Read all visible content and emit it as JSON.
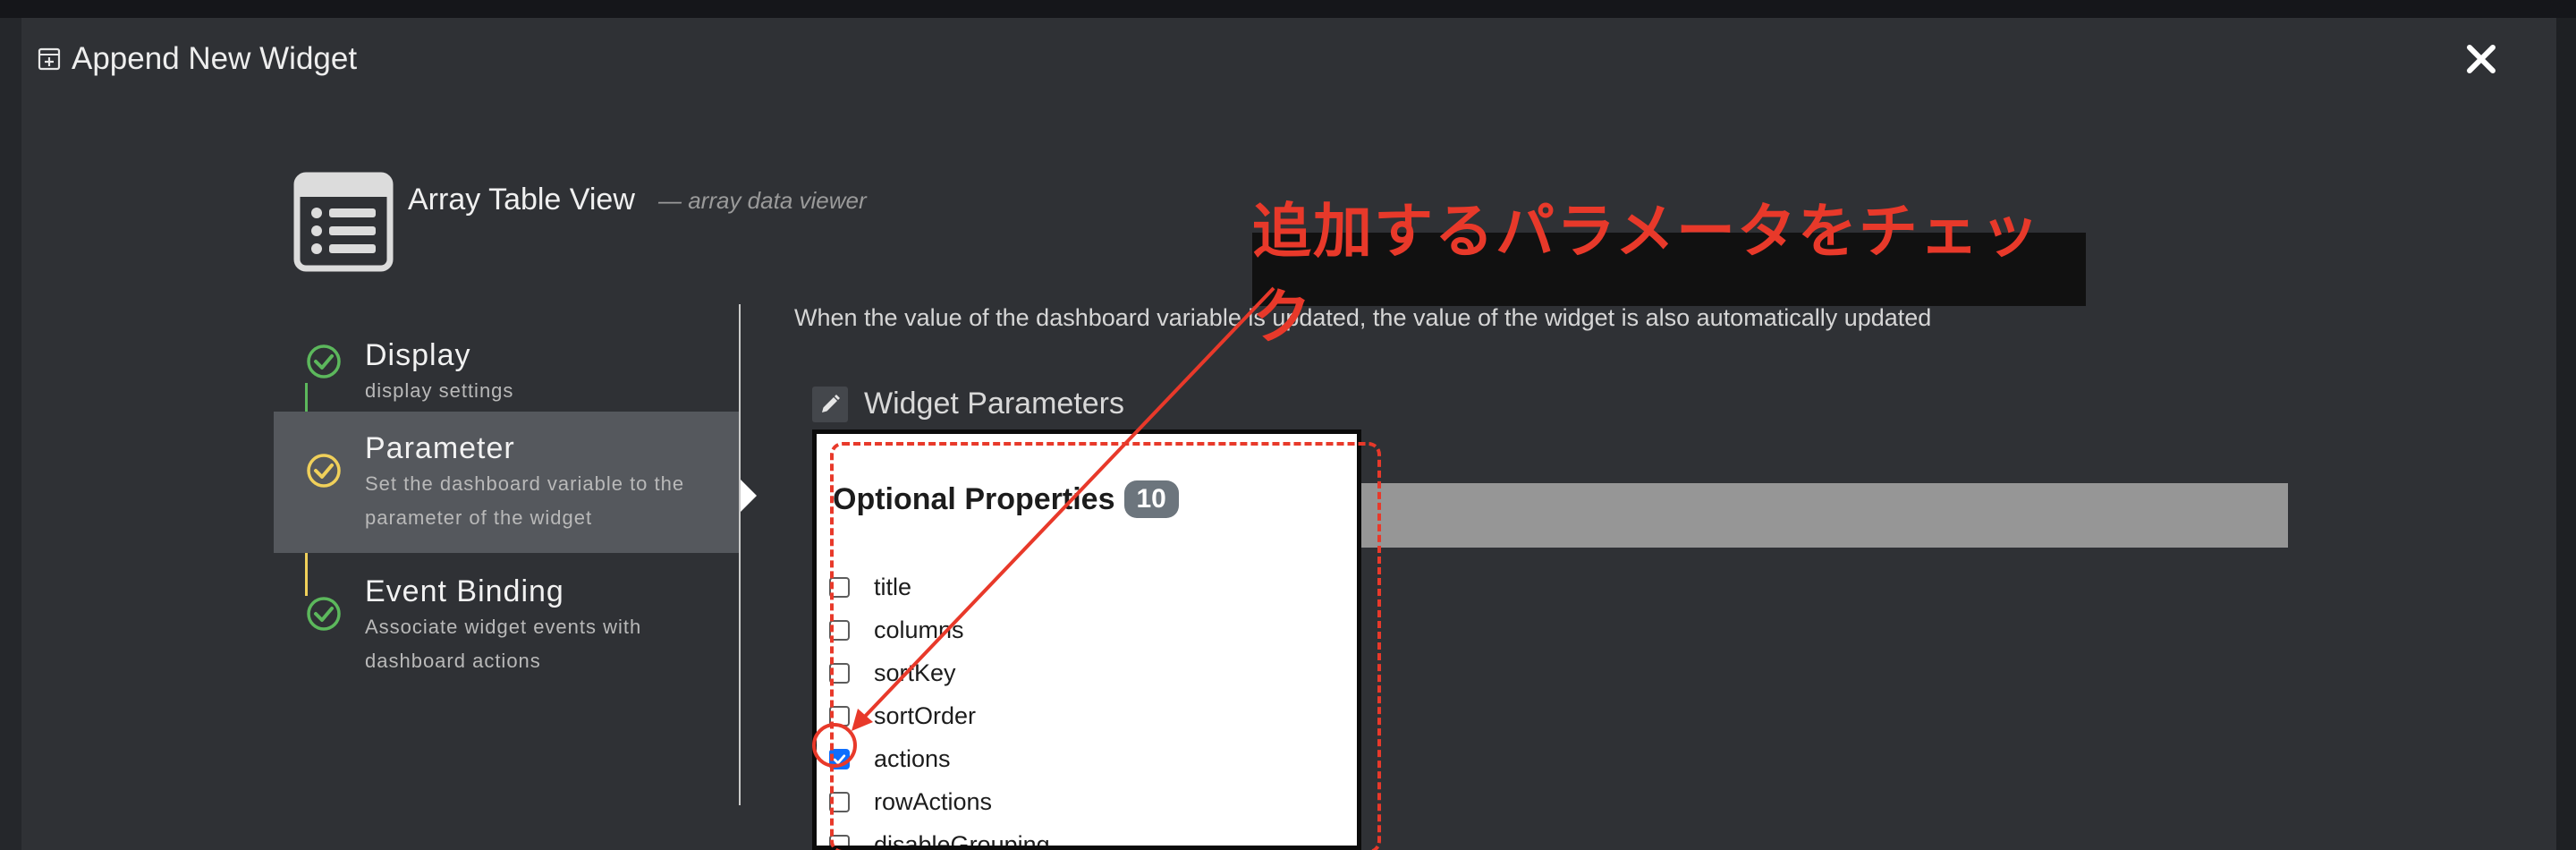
{
  "modal": {
    "title": "Append New Widget",
    "close_symbol": "✕"
  },
  "widget": {
    "name": "Array Table View",
    "description": "— array data viewer"
  },
  "steps": [
    {
      "label": "Display",
      "sub": "display settings",
      "state": "done"
    },
    {
      "label": "Parameter",
      "sub": "Set the dashboard variable to the parameter of the widget",
      "state": "active"
    },
    {
      "label": "Event Binding",
      "sub": "Associate widget events with dashboard actions",
      "state": "done"
    }
  ],
  "main": {
    "info_text": "When the value of the dashboard variable is updated, the value of the widget is also automatically updated",
    "section_title": "Widget Parameters"
  },
  "popup": {
    "title": "Optional Properties",
    "count": "10",
    "properties": [
      {
        "label": "title",
        "checked": false
      },
      {
        "label": "columns",
        "checked": false
      },
      {
        "label": "sortKey",
        "checked": false
      },
      {
        "label": "sortOrder",
        "checked": false
      },
      {
        "label": "actions",
        "checked": true
      },
      {
        "label": "rowActions",
        "checked": false
      },
      {
        "label": "disableGrouping",
        "checked": false
      }
    ]
  },
  "annotation": {
    "label": "追加するパラメータをチェック"
  },
  "colors": {
    "accent_done": "#5cb85c",
    "accent_active": "#f0d05a",
    "annotation": "#e8392a",
    "checkbox": "#0d6efd"
  },
  "icons": {
    "title_icon": "add-box-icon",
    "widget_icon": "list-icon",
    "edit_icon": "pencil-icon",
    "step_icon": "check-circle-icon"
  }
}
